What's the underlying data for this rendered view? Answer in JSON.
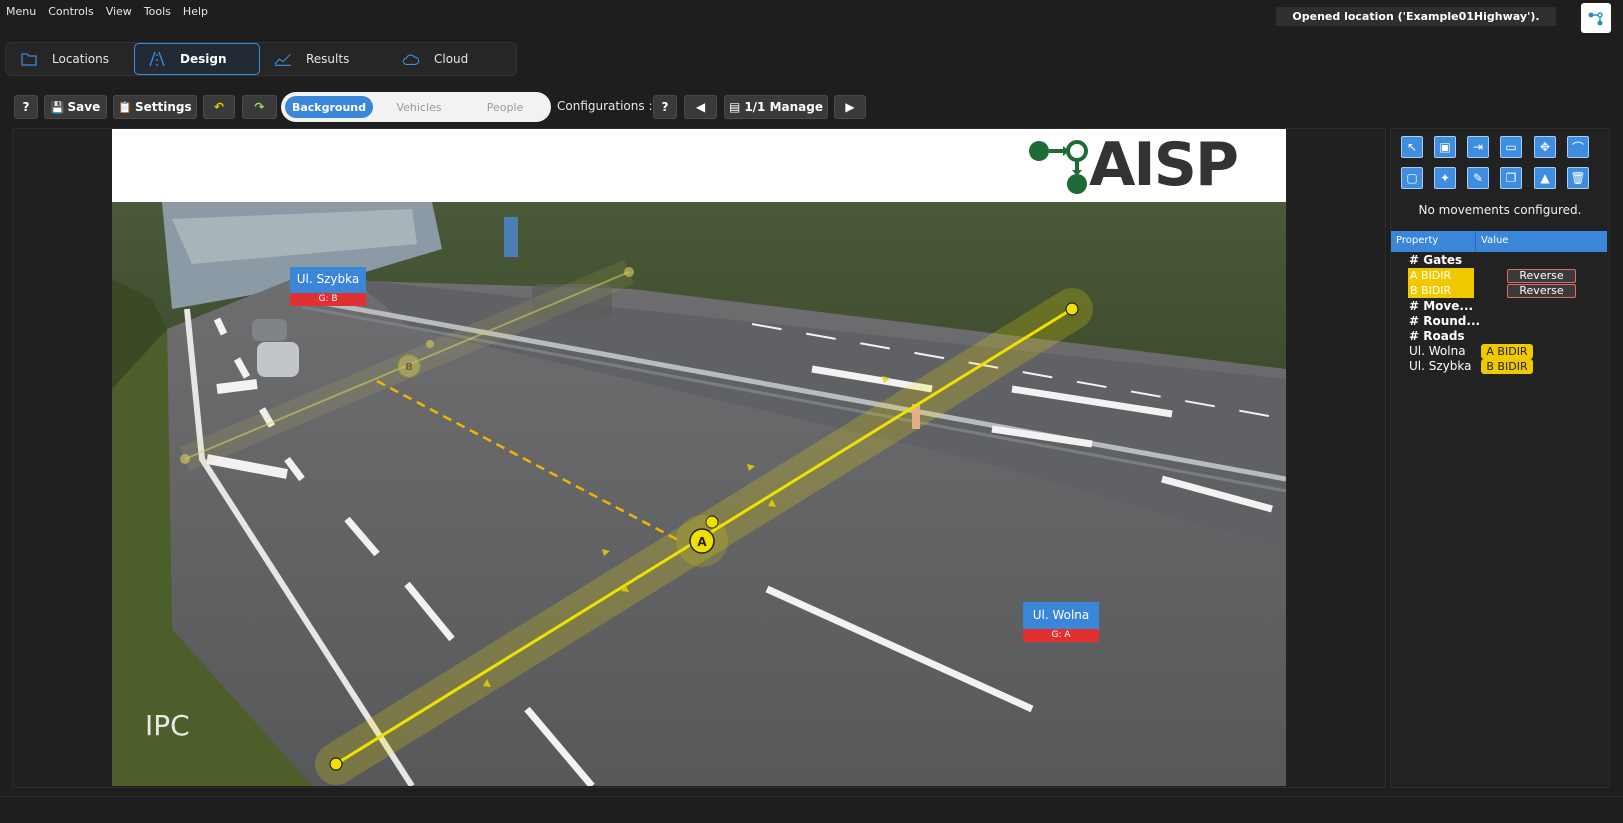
{
  "menubar": {
    "items": [
      "Menu",
      "Controls",
      "View",
      "Tools",
      "Help"
    ],
    "status": "Opened location ('Example01Highway')."
  },
  "tabs": [
    {
      "label": "Locations",
      "icon": "folder-icon"
    },
    {
      "label": "Design",
      "icon": "road-icon",
      "active": true
    },
    {
      "label": "Results",
      "icon": "chart-icon"
    },
    {
      "label": "Cloud",
      "icon": "cloud-icon"
    }
  ],
  "toolbar": {
    "help_label": "?",
    "save_label": "Save",
    "settings_label": "Settings",
    "mode_options": [
      "Background",
      "Vehicles",
      "People"
    ],
    "active_mode": "Background",
    "configurations_label": "Configurations :",
    "config_help": "?",
    "manage_label": "1/1 Manage"
  },
  "canvas": {
    "logo_text": "AISP",
    "watermark": "IPC",
    "road_labels": [
      {
        "name": "Ul. Szybka",
        "gate": "G: B"
      },
      {
        "name": "Ul. Wolna",
        "gate": "G: A"
      }
    ],
    "gate_markers": [
      "A",
      "B"
    ]
  },
  "side_panel": {
    "tools": [
      "select-icon",
      "add-gate-icon",
      "export-icon",
      "save-icon",
      "target-icon",
      "curve-icon",
      "region-icon",
      "magic-wand-icon",
      "eraser-icon",
      "copy-icon",
      "mountain-icon",
      "delete-icon"
    ],
    "no_movements": "No movements configured.",
    "columns": {
      "property": "Property",
      "value": "Value"
    },
    "sections": {
      "gates": "# Gates",
      "movements": "# Move...",
      "roundabouts": "# Round...",
      "roads": "# Roads"
    },
    "gates": [
      {
        "label": "A BIDIR",
        "action": "Reverse"
      },
      {
        "label": "B BIDIR",
        "action": "Reverse"
      }
    ],
    "roads": [
      {
        "name": "Ul. Wolna",
        "gate": "A BIDIR"
      },
      {
        "name": "Ul. Szybka",
        "gate": "B BIDIR"
      }
    ]
  },
  "colors": {
    "accent": "#3a86d9",
    "gate": "#f0e000",
    "label_red": "#e03030"
  }
}
